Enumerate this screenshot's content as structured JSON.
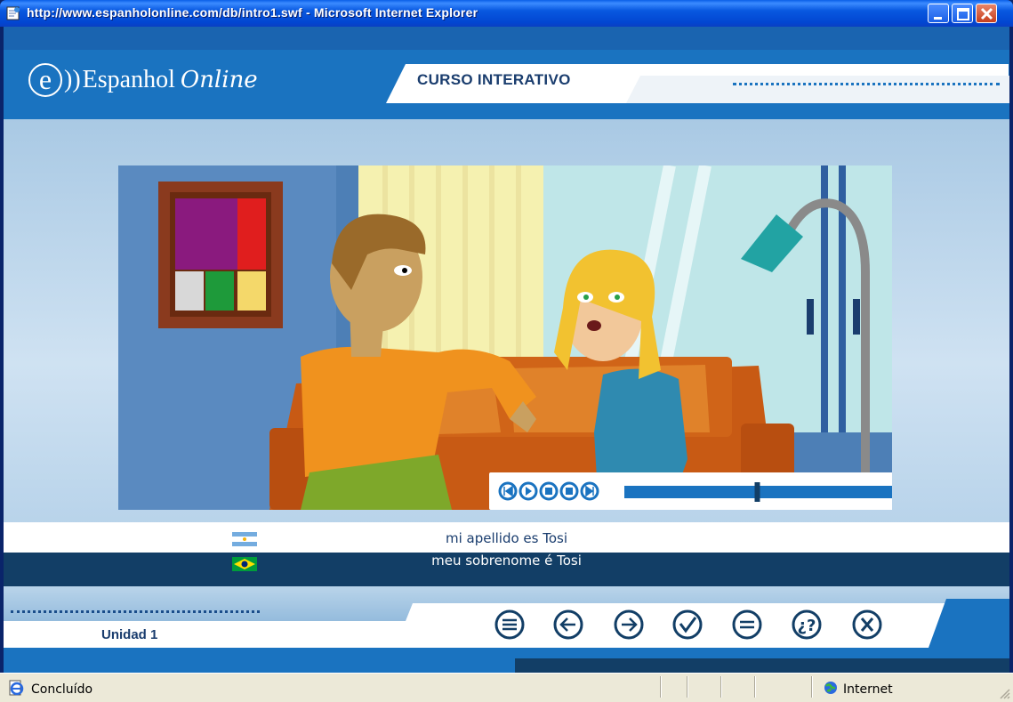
{
  "window": {
    "title": "http://www.espanholonline.com/db/intro1.swf - Microsoft Internet Explorer",
    "buttons": [
      "minimize",
      "maximize",
      "close"
    ]
  },
  "header": {
    "logo_e": "e",
    "logo_waves": "))",
    "logo_word1": "Espanhol",
    "logo_word2": "Online",
    "tab_title": "CURSO INTERATIVO"
  },
  "player": {
    "controls": [
      "rewind-start",
      "play",
      "pause",
      "stop",
      "forward-end"
    ],
    "progress": 0.49
  },
  "captions": {
    "spanish": "mi apellido es Tosi",
    "portuguese": "meu sobrenome é Tosi"
  },
  "footer": {
    "unit_label": "Unidad 1",
    "nav_buttons": [
      "menu",
      "previous",
      "next",
      "check",
      "text",
      "help",
      "close"
    ]
  },
  "statusbar": {
    "status": "Concluído",
    "zone": "Internet"
  },
  "colors": {
    "brand_blue": "#1a73c0",
    "dark_navy": "#123e66",
    "accent_orange": "#f0921e"
  }
}
